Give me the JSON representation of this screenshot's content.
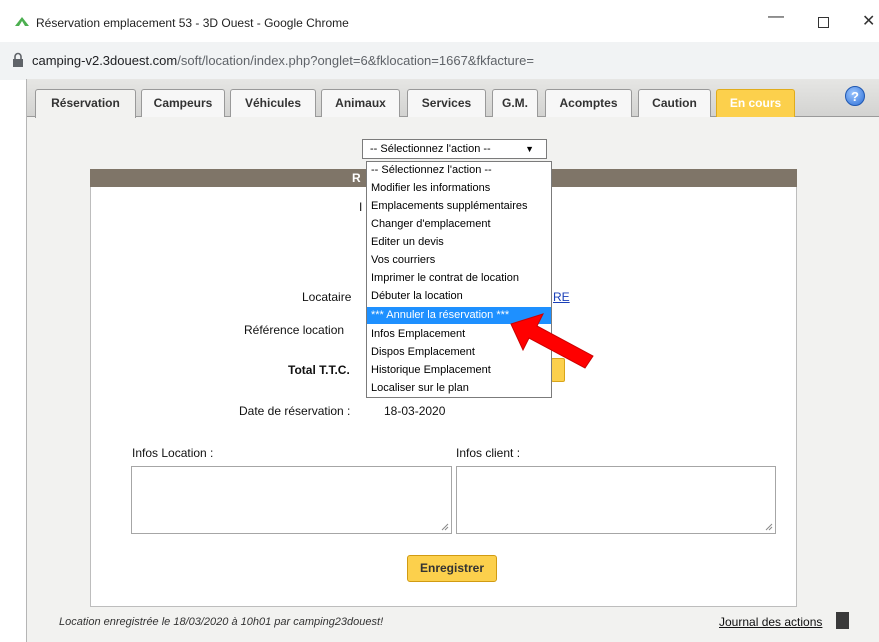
{
  "window": {
    "title": "Réservation emplacement 53 - 3D Ouest - Google Chrome",
    "minimize": "—",
    "close": "✕"
  },
  "address": {
    "host": "camping-v2.3douest.com",
    "path": "/soft/location/index.php?onglet=6&fklocation=1667&fkfacture="
  },
  "tabs": [
    {
      "label": "Réservation"
    },
    {
      "label": "Campeurs"
    },
    {
      "label": "Véhicules"
    },
    {
      "label": "Animaux"
    },
    {
      "label": "Services"
    },
    {
      "label": "G.M."
    },
    {
      "label": "Acomptes"
    },
    {
      "label": "Caution"
    },
    {
      "label": "En cours"
    }
  ],
  "help": {
    "glyph": "?"
  },
  "action_select": {
    "value": "-- Sélectionnez l'action --",
    "arrow": "▼"
  },
  "dropdown": {
    "items": [
      "-- Sélectionnez l'action --",
      "Modifier les informations",
      "Emplacements supplémentaires",
      "Changer d'emplacement",
      "Editer un devis",
      "Vos courriers",
      "Imprimer le contrat de location",
      "Débuter la location",
      "*** Annuler la réservation ***",
      "Infos Emplacement",
      "Dispos Emplacement",
      "Historique Emplacement",
      "Localiser sur le plan"
    ],
    "selected_index": 8
  },
  "panel": {
    "header_fragment": "R",
    "body_fragment": "I",
    "locataire_label": "Locataire",
    "locataire_link_fragment": "RE",
    "reference_label": "Référence location",
    "total_label": "Total T.T.C.",
    "date_label": "Date de réservation :",
    "date_value": "18-03-2020",
    "infos_location_label": "Infos Location :",
    "infos_client_label": "Infos client :"
  },
  "save_button": "Enregistrer",
  "footer": {
    "status": "Location enregistrée le 18/03/2020 à 10h01 par camping23douest!",
    "journal": "Journal des actions"
  },
  "colors": {
    "accent_yellow": "#fcd04c",
    "panel_header": "#7f7568",
    "selection_blue": "#1e90ff",
    "arrow_red": "#ff0000"
  }
}
